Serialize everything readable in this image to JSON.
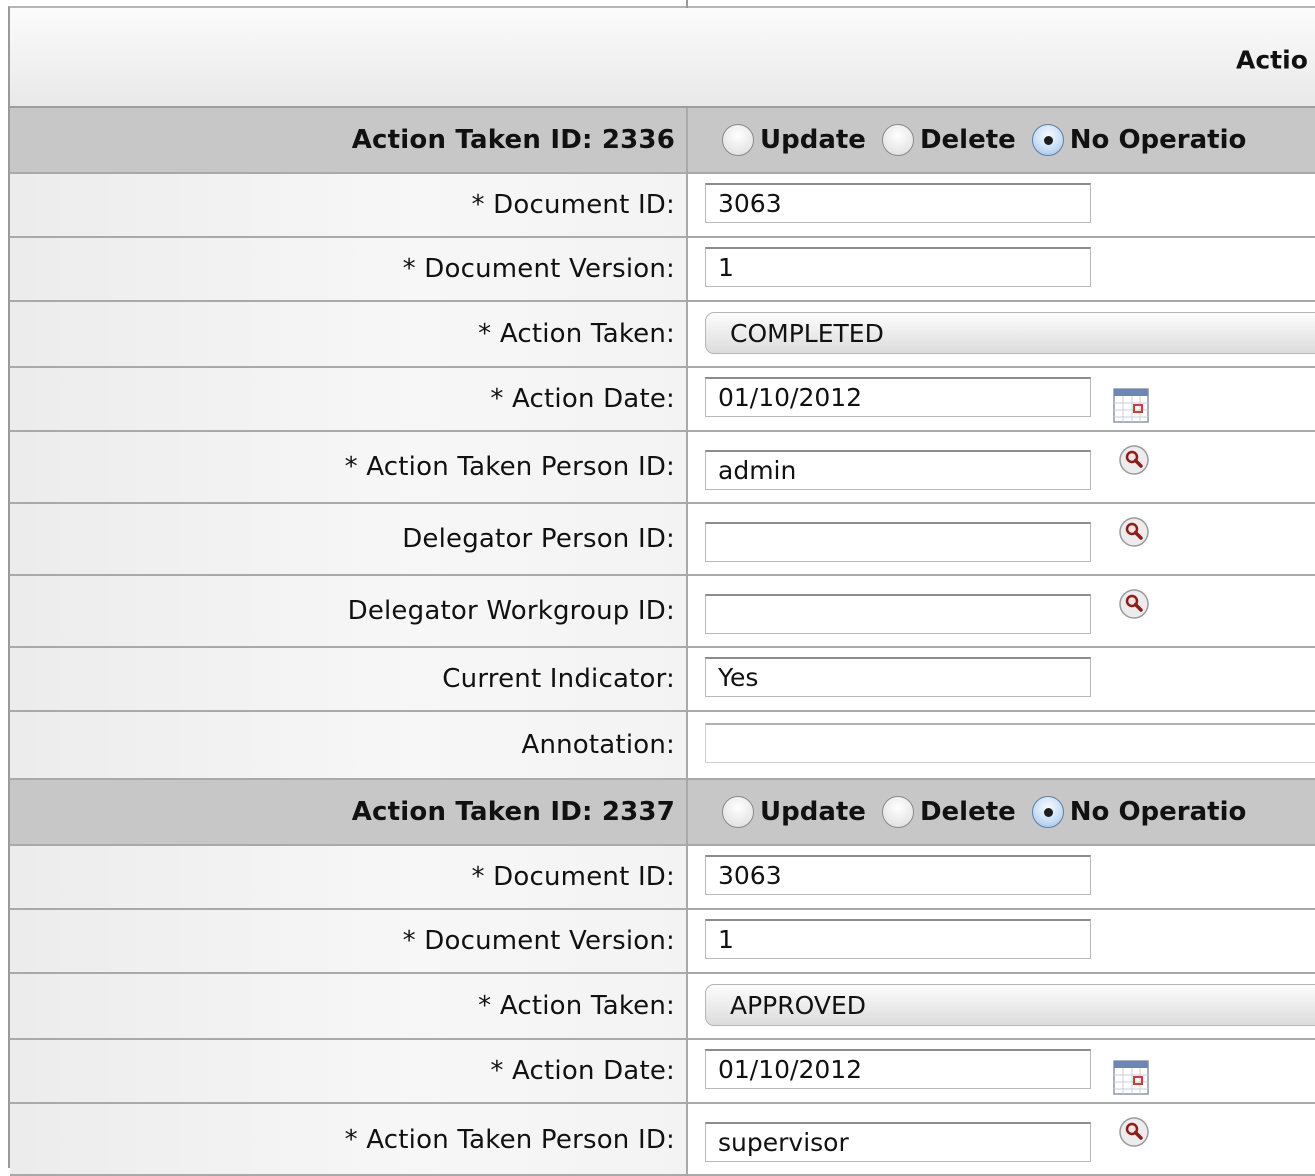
{
  "header": {
    "title": "Actio"
  },
  "radio_options": [
    "Update",
    "Delete",
    "No Operatio"
  ],
  "records": [
    {
      "section_label": "Action Taken ID: 2336",
      "selected_option": "No Operatio",
      "fields": {
        "document_id": {
          "label": "* Document ID:",
          "value": "3063"
        },
        "document_version": {
          "label": "* Document Version:",
          "value": "1"
        },
        "action_taken": {
          "label": "* Action Taken:",
          "value": "COMPLETED"
        },
        "action_date": {
          "label": "* Action Date:",
          "value": "01/10/2012"
        },
        "action_taken_person_id": {
          "label": "* Action Taken Person ID:",
          "value": "admin"
        },
        "delegator_person_id": {
          "label": "Delegator Person ID:",
          "value": ""
        },
        "delegator_workgroup_id": {
          "label": "Delegator Workgroup ID:",
          "value": ""
        },
        "current_indicator": {
          "label": "Current Indicator:",
          "value": "Yes"
        },
        "annotation": {
          "label": "Annotation:",
          "value": ""
        }
      }
    },
    {
      "section_label": "Action Taken ID: 2337",
      "selected_option": "No Operatio",
      "fields": {
        "document_id": {
          "label": "* Document ID:",
          "value": "3063"
        },
        "document_version": {
          "label": "* Document Version:",
          "value": "1"
        },
        "action_taken": {
          "label": "* Action Taken:",
          "value": "APPROVED"
        },
        "action_date": {
          "label": "* Action Date:",
          "value": "01/10/2012"
        },
        "action_taken_person_id": {
          "label": "* Action Taken Person ID:",
          "value": "supervisor"
        }
      }
    }
  ],
  "icons": {
    "calendar": "calendar-icon",
    "lookup": "magnifier-lookup-icon"
  }
}
